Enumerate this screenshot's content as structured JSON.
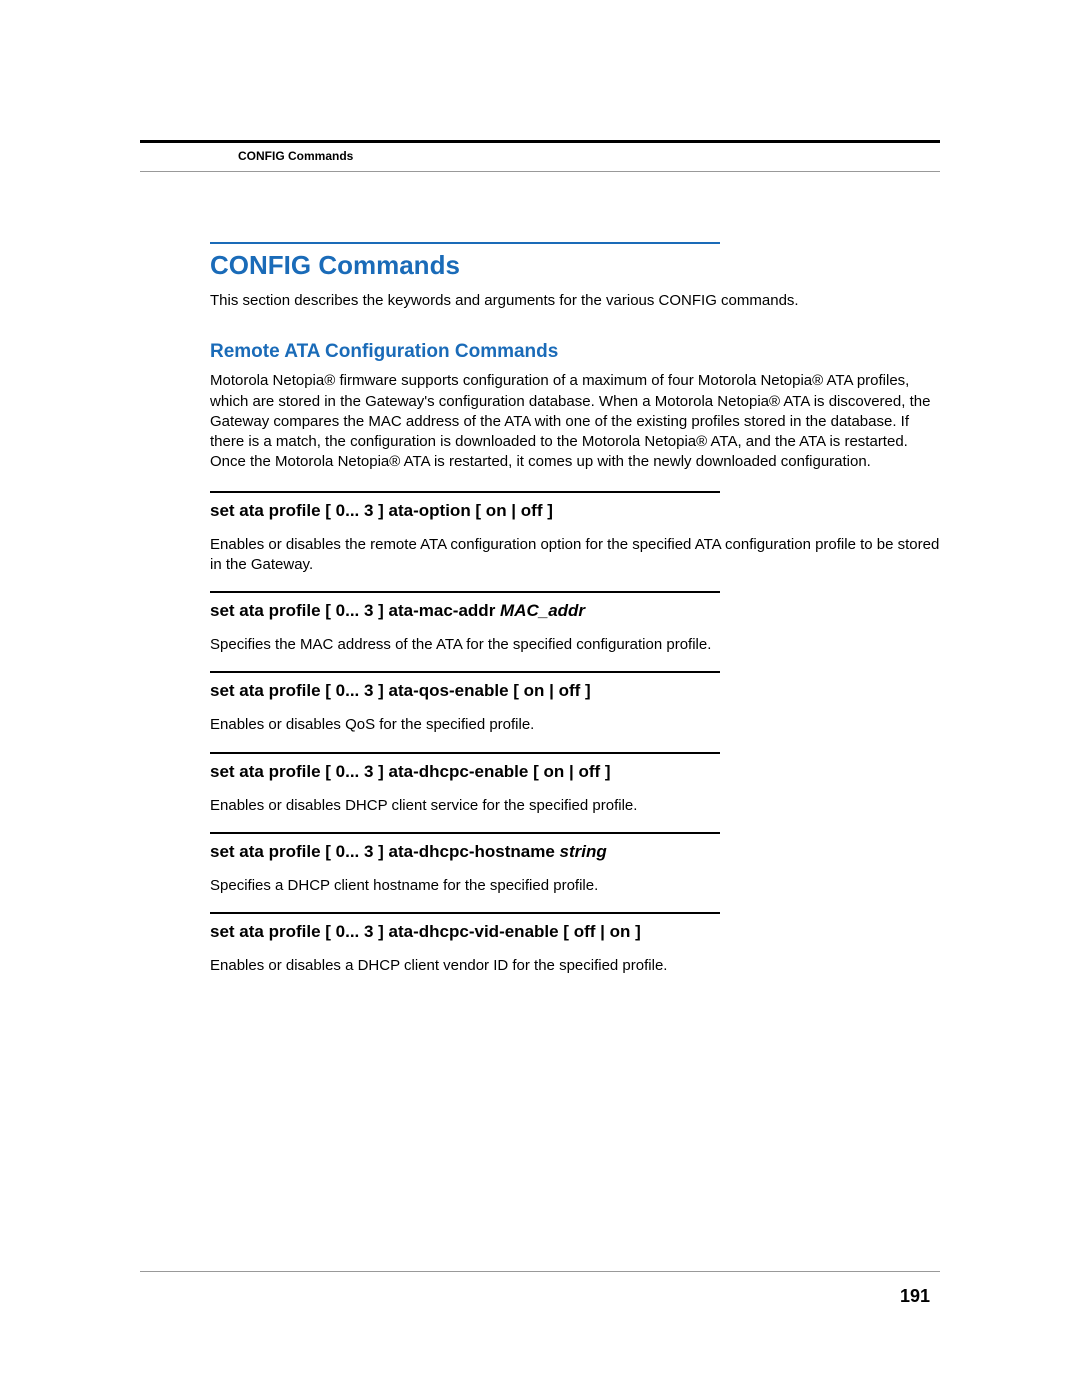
{
  "header": {
    "section_label": "CONFIG Commands"
  },
  "main": {
    "title": "CONFIG Commands",
    "intro": "This section describes the keywords and arguments for the various CONFIG commands.",
    "subsection_title": "Remote ATA Configuration Commands",
    "subsection_body": "Motorola Netopia® firmware supports configuration of a maximum of four Motorola Netopia® ATA profiles, which are stored in the Gateway's configuration database. When a Motorola Netopia® ATA is discovered, the Gateway compares the MAC address of the ATA with one of the existing profiles stored in the database. If there is a match, the configuration is downloaded to the Motorola Netopia® ATA, and the ATA is restarted. Once the Motorola Netopia® ATA is restarted, it comes up with the newly downloaded configuration.",
    "commands": [
      {
        "heading_plain": "set ata profile [  0... 3 ] ata-option [ on | off ]",
        "heading_italic": "",
        "desc": "Enables or disables the remote ATA configuration option for the specified ATA configuration profile to be stored in the Gateway."
      },
      {
        "heading_plain": "set ata profile [  0... 3 ] ata-mac-addr ",
        "heading_italic": "MAC_addr",
        "desc": "Specifies the MAC address of the ATA for the specified configuration profile."
      },
      {
        "heading_plain": "set ata profile [  0... 3 ] ata-qos-enable [ on | off ]",
        "heading_italic": "",
        "desc": "Enables or disables QoS for the specified profile."
      },
      {
        "heading_plain": "set ata profile [  0... 3 ] ata-dhcpc-enable [ on | off ]",
        "heading_italic": "",
        "desc": "Enables or disables DHCP client service for the specified profile."
      },
      {
        "heading_plain": "set ata profile [  0... 3 ] ata-dhcpc-hostname ",
        "heading_italic": "string",
        "desc": "Specifies a DHCP client hostname for the specified profile."
      },
      {
        "heading_plain": "set ata profile [  0... 3 ] ata-dhcpc-vid-enable [ off | on ]",
        "heading_italic": "",
        "desc": "Enables or disables a DHCP client vendor ID for the specified profile."
      }
    ]
  },
  "footer": {
    "page_number": "191"
  }
}
